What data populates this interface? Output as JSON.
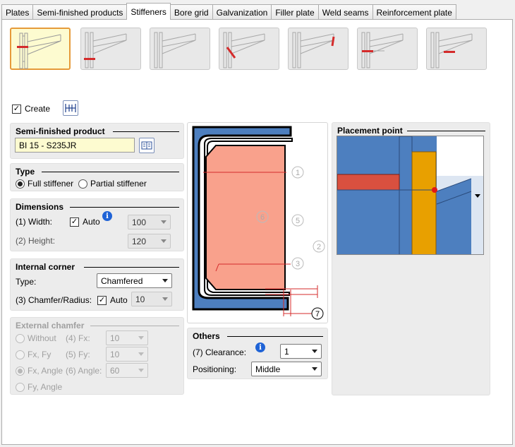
{
  "tabs": [
    {
      "label": "Plates",
      "active": false
    },
    {
      "label": "Semi-finished products",
      "active": false
    },
    {
      "label": "Stiffeners",
      "active": true
    },
    {
      "label": "Bore grid",
      "active": false
    },
    {
      "label": "Galvanization",
      "active": false
    },
    {
      "label": "Filler plate",
      "active": false
    },
    {
      "label": "Weld seams",
      "active": false
    },
    {
      "label": "Reinforcement plate",
      "active": false
    }
  ],
  "create": {
    "label": "Create",
    "checked": true
  },
  "semi_finished": {
    "title": "Semi-finished product",
    "value": "BI 15 - S235JR"
  },
  "type": {
    "title": "Type",
    "full": "Full stiffener",
    "partial": "Partial stiffener",
    "selected": "full"
  },
  "dimensions": {
    "title": "Dimensions",
    "width_label": "(1) Width:",
    "auto_label": "Auto",
    "width_value": "100",
    "height_label": "(2) Height:",
    "height_value": "120"
  },
  "internal_corner": {
    "title": "Internal corner",
    "type_label": "Type:",
    "type_value": "Chamfered",
    "chamfer_label": "(3) Chamfer/Radius:",
    "auto_label": "Auto",
    "chamfer_value": "10"
  },
  "external_chamfer": {
    "title": "External chamfer",
    "without": "Without",
    "fxfy": "Fx, Fy",
    "fxangle": "Fx, Angle",
    "fyangle": "Fy, Angle",
    "fx_label": "(4) Fx:",
    "fx_value": "10",
    "fy_label": "(5) Fy:",
    "fy_value": "10",
    "angle_label": "(6) Angle:",
    "angle_value": "60"
  },
  "others": {
    "title": "Others",
    "clearance_label": "(7) Clearance:",
    "clearance_value": "1",
    "positioning_label": "Positioning:",
    "positioning_value": "Middle"
  },
  "placement": {
    "title": "Placement point"
  },
  "diagram_labels": [
    "1",
    "2",
    "3",
    "5",
    "6",
    "7"
  ],
  "colors": {
    "accent_orange": "#e69a3a",
    "stiffener_red": "#d42b2b",
    "beam_blue": "#4d7fbf",
    "plate_orange": "#e8a000",
    "profile_salmon": "#f9a18c"
  }
}
